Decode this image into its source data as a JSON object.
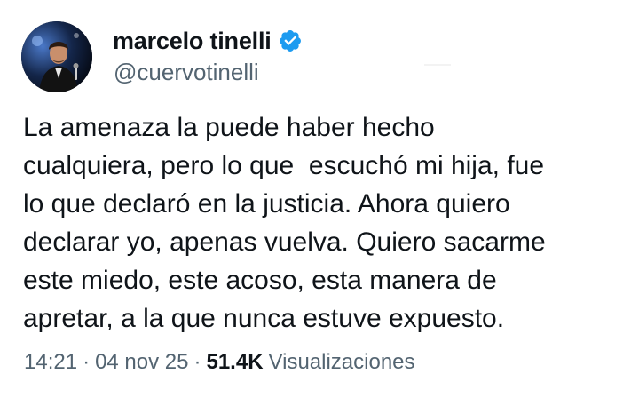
{
  "tweet": {
    "author": {
      "display_name": "marcelo tinelli",
      "handle": "@cuervotinelli",
      "verified": true,
      "verified_color": "#1d9bf0",
      "avatar_icon": "profile-photo"
    },
    "text": "La amenaza la puede haber hecho\ncualquiera, pero lo que  escuchó mi hija, fue\nlo que declaró en la justicia. Ahora quiero\ndeclarar yo, apenas vuelva. Quiero sacarme\neste miedo, este acoso, esta manera de\napretar, a la que nunca estuve expuesto.",
    "meta": {
      "time": "14:21",
      "separator": "·",
      "date": "04 nov 25",
      "views_count": "51.4K",
      "views_label": "Visualizaciones"
    }
  }
}
